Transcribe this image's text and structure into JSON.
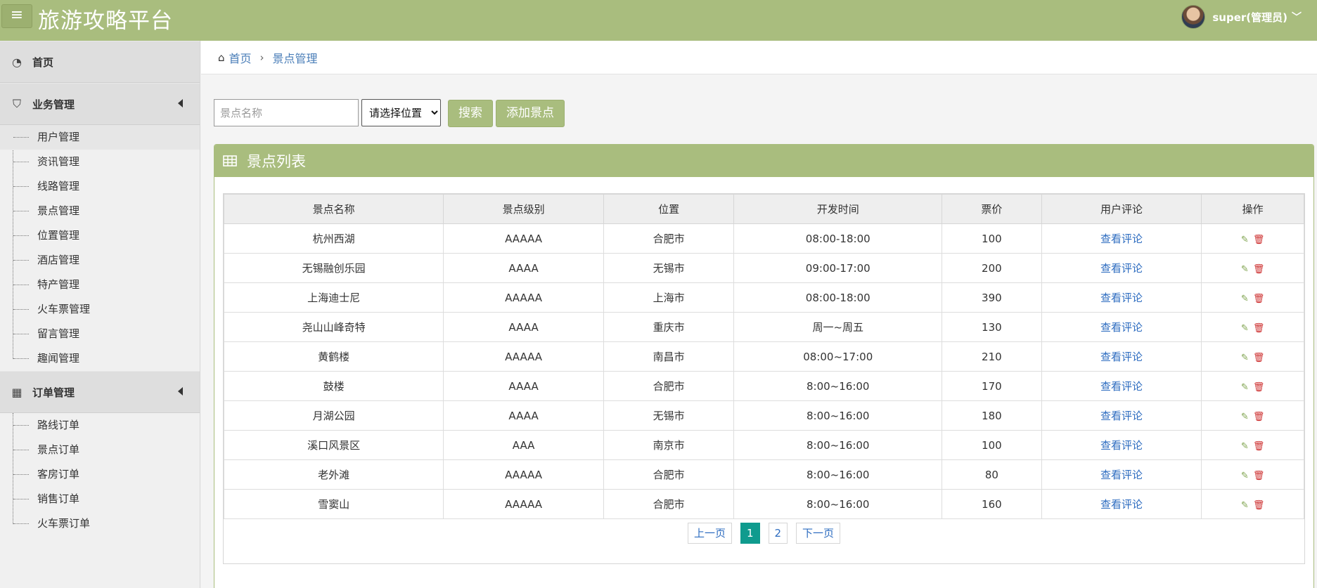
{
  "header": {
    "menu_icon": "≡",
    "brand": "旅游攻略平台",
    "user_name": "super(管理员)"
  },
  "sidebar": {
    "home": "首页",
    "business": {
      "label": "业务管理",
      "items": [
        "用户管理",
        "资讯管理",
        "线路管理",
        "景点管理",
        "位置管理",
        "酒店管理",
        "特产管理",
        "火车票管理",
        "留言管理",
        "趣闻管理"
      ]
    },
    "orders": {
      "label": "订单管理",
      "items": [
        "路线订单",
        "景点订单",
        "客房订单",
        "销售订单",
        "火车票订单"
      ]
    }
  },
  "breadcrumb": {
    "home": "首页",
    "current": "景点管理"
  },
  "search": {
    "name_placeholder": "景点名称",
    "location_selected": "请选择位置",
    "search_label": "搜索",
    "add_label": "添加景点"
  },
  "panel": {
    "title": "景点列表"
  },
  "table": {
    "headers": [
      "景点名称",
      "景点级别",
      "位置",
      "开发时间",
      "票价",
      "用户评论",
      "操作"
    ],
    "comment_link": "查看评论",
    "rows": [
      [
        "杭州西湖",
        "AAAAA",
        "合肥市",
        "08:00-18:00",
        "100"
      ],
      [
        "无锡融创乐园",
        "AAAA",
        "无锡市",
        "09:00-17:00",
        "200"
      ],
      [
        "上海迪士尼",
        "AAAAA",
        "上海市",
        "08:00-18:00",
        "390"
      ],
      [
        "尧山山峰奇特",
        "AAAA",
        "重庆市",
        "周一~周五",
        "130"
      ],
      [
        "黄鹤楼",
        "AAAAA",
        "南昌市",
        "08:00~17:00",
        "210"
      ],
      [
        "鼓楼",
        "AAAA",
        "合肥市",
        "8:00~16:00",
        "170"
      ],
      [
        "月湖公园",
        "AAAA",
        "无锡市",
        "8:00~16:00",
        "180"
      ],
      [
        "溪口风景区",
        "AAA",
        "南京市",
        "8:00~16:00",
        "100"
      ],
      [
        "老外滩",
        "AAAAA",
        "合肥市",
        "8:00~16:00",
        "80"
      ],
      [
        "雪窦山",
        "AAAAA",
        "合肥市",
        "8:00~16:00",
        "160"
      ]
    ]
  },
  "pager": {
    "prev": "上一页",
    "pages": [
      "1",
      "2"
    ],
    "current": "1",
    "next": "下一页"
  },
  "colors": {
    "accent": "#a9bd7e",
    "link": "#2d6cc0",
    "pager_active": "#0f9b8e"
  }
}
